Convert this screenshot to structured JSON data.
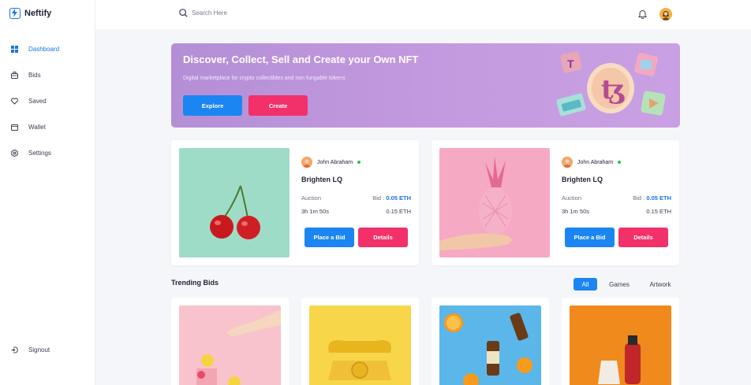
{
  "app": {
    "name": "Neftify"
  },
  "sidebar": {
    "items": [
      {
        "label": "Dashboard",
        "icon": "grid-icon",
        "active": true
      },
      {
        "label": "Bids",
        "icon": "briefcase-icon"
      },
      {
        "label": "Saved",
        "icon": "heart-icon"
      },
      {
        "label": "Wallet",
        "icon": "wallet-icon"
      },
      {
        "label": "Settings",
        "icon": "gear-icon"
      }
    ],
    "signout": "Signout"
  },
  "search": {
    "placeholder": "Search Here"
  },
  "banner": {
    "title": "Discover, Collect, Sell and Create your Own NFT",
    "subtitle": "Digital marketplace for crypto collectibles and non fungable tokens",
    "explore_label": "Explore",
    "create_label": "Create"
  },
  "auctions": [
    {
      "owner": "John Abraham",
      "title": "Brighten LQ",
      "auction_label": "Auction",
      "bid_label": "Bid :",
      "bid_value": "0.05 ETH",
      "time": "3h 1m 50s",
      "price": "0.15 ETH",
      "place_bid_label": "Place a Bid",
      "details_label": "Details"
    },
    {
      "owner": "John Abraham",
      "title": "Brighten LQ",
      "auction_label": "Auction",
      "bid_label": "Bid :",
      "bid_value": "0.05 ETH",
      "time": "3h 1m 50s",
      "price": "0.15 ETH",
      "place_bid_label": "Place a Bid",
      "details_label": "Details"
    }
  ],
  "trending": {
    "title": "Trending Bids",
    "filters": [
      "All",
      "Games",
      "Artwork"
    ],
    "active_filter": "All"
  },
  "colors": {
    "accent": "#1b85f2",
    "pink": "#f2306a",
    "banner": "#c59be0"
  }
}
